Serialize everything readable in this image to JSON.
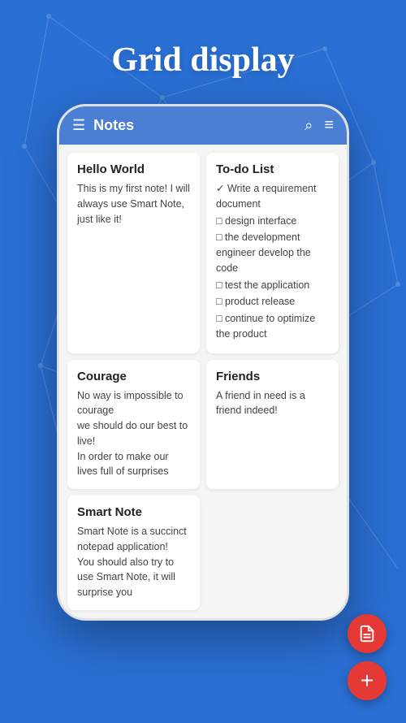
{
  "page": {
    "title": "Grid display",
    "background_color": "#2a6fd4"
  },
  "header": {
    "title": "Notes",
    "hamburger_icon": "☰",
    "search_icon": "⌕",
    "filter_icon": "≡"
  },
  "notes": [
    {
      "id": "hello-world",
      "title": "Hello World",
      "body": "This is my first note! I will always use Smart Note, just like it!",
      "type": "text"
    },
    {
      "id": "to-do-list",
      "title": "To-do List",
      "type": "checklist",
      "items": [
        {
          "checked": true,
          "text": "Write a requirement document"
        },
        {
          "checked": false,
          "text": "design interface"
        },
        {
          "checked": false,
          "text": "the development engineer develop the code"
        },
        {
          "checked": false,
          "text": "test the application"
        },
        {
          "checked": false,
          "text": "product release"
        },
        {
          "checked": false,
          "text": "continue to optimize the product"
        }
      ]
    },
    {
      "id": "courage",
      "title": "Courage",
      "body": "No way is impossible to courage\nwe should do our best to live!\nIn order to make our lives full of surprises",
      "type": "text"
    },
    {
      "id": "friends",
      "title": "Friends",
      "body": "A friend in need is a friend indeed!",
      "type": "text"
    },
    {
      "id": "smart-note",
      "title": "Smart Note",
      "body": "Smart Note is a succinct notepad application!\nYou should also try to use Smart Note, it will surprise you",
      "type": "text"
    }
  ],
  "fabs": {
    "doc_icon": "🗒",
    "add_icon": "+"
  }
}
